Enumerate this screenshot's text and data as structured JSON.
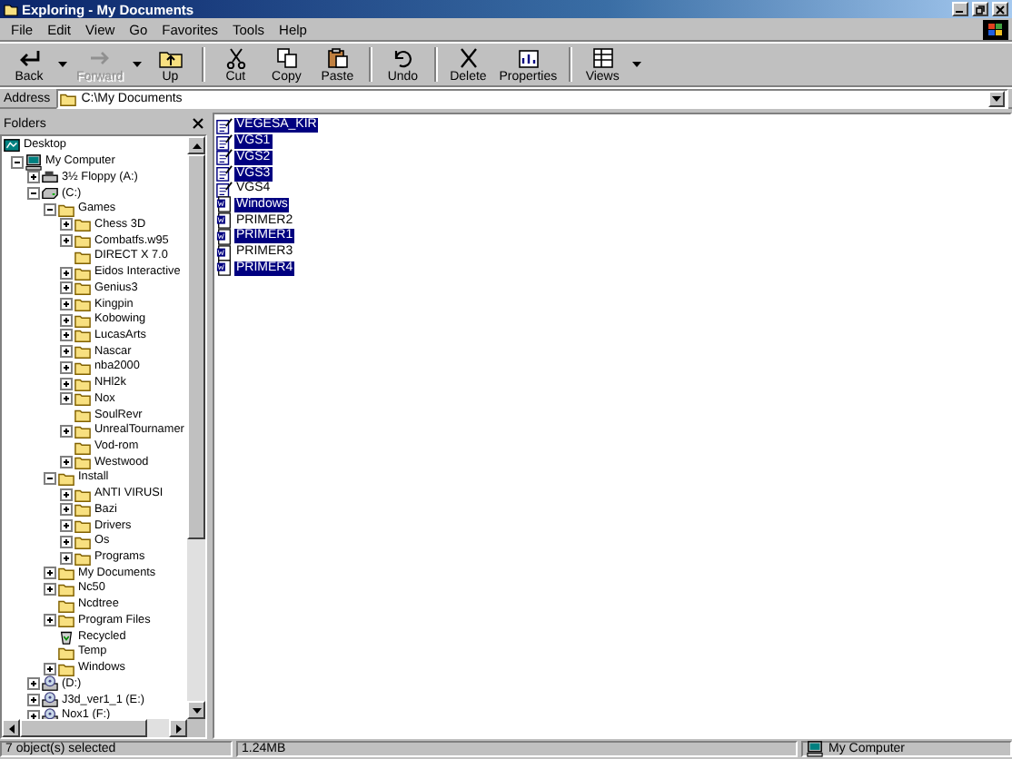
{
  "window": {
    "title": "Exploring - My Documents"
  },
  "menu": [
    "File",
    "Edit",
    "View",
    "Go",
    "Favorites",
    "Tools",
    "Help"
  ],
  "toolbar": [
    [
      {
        "label": "Back",
        "kind": "back",
        "disabled": false,
        "dropdown": true
      },
      {
        "label": "Forward",
        "kind": "forward",
        "disabled": true,
        "dropdown": true
      },
      {
        "label": "Up",
        "kind": "up",
        "disabled": false,
        "dropdown": false
      }
    ],
    [
      {
        "label": "Cut",
        "kind": "cut",
        "disabled": false,
        "dropdown": false
      },
      {
        "label": "Copy",
        "kind": "copy",
        "disabled": false,
        "dropdown": false
      },
      {
        "label": "Paste",
        "kind": "paste",
        "disabled": false,
        "dropdown": false
      }
    ],
    [
      {
        "label": "Undo",
        "kind": "undo",
        "disabled": false,
        "dropdown": false
      }
    ],
    [
      {
        "label": "Delete",
        "kind": "delete",
        "disabled": false,
        "dropdown": false
      },
      {
        "label": "Properties",
        "kind": "properties",
        "disabled": false,
        "dropdown": false
      }
    ],
    [
      {
        "label": "Views",
        "kind": "views",
        "disabled": false,
        "dropdown": true
      }
    ]
  ],
  "address": {
    "label": "Address",
    "value": "C:\\My Documents"
  },
  "folders": {
    "title": "Folders",
    "tree": [
      {
        "label": "Desktop",
        "kind": "desktop",
        "children": [
          {
            "label": "My Computer",
            "kind": "computer",
            "expanded": true,
            "children": [
              {
                "label": "3½ Floppy (A:)",
                "kind": "floppy",
                "expanded": false
              },
              {
                "label": "(C:)",
                "kind": "drive",
                "expanded": true,
                "children": [
                  {
                    "label": "Games",
                    "kind": "folder",
                    "expanded": true,
                    "children": [
                      {
                        "label": "Chess 3D",
                        "kind": "folder",
                        "expanded": false
                      },
                      {
                        "label": "Combatfs.w95",
                        "kind": "folder",
                        "expanded": false
                      },
                      {
                        "label": "DIRECT X 7.0",
                        "kind": "folder"
                      },
                      {
                        "label": "Eidos Interactive",
                        "kind": "folder",
                        "expanded": false
                      },
                      {
                        "label": "Genius3",
                        "kind": "folder",
                        "expanded": false
                      },
                      {
                        "label": "Kingpin",
                        "kind": "folder",
                        "expanded": false
                      },
                      {
                        "label": "Kobowing",
                        "kind": "folder",
                        "expanded": false
                      },
                      {
                        "label": "LucasArts",
                        "kind": "folder",
                        "expanded": false
                      },
                      {
                        "label": "Nascar",
                        "kind": "folder",
                        "expanded": false
                      },
                      {
                        "label": "nba2000",
                        "kind": "folder",
                        "expanded": false
                      },
                      {
                        "label": "NHl2k",
                        "kind": "folder",
                        "expanded": false
                      },
                      {
                        "label": "Nox",
                        "kind": "folder",
                        "expanded": false
                      },
                      {
                        "label": "SoulRevr",
                        "kind": "folder"
                      },
                      {
                        "label": "UnrealTournamer",
                        "kind": "folder",
                        "expanded": false
                      },
                      {
                        "label": "Vod-rom",
                        "kind": "folder"
                      },
                      {
                        "label": "Westwood",
                        "kind": "folder",
                        "expanded": false
                      }
                    ]
                  },
                  {
                    "label": "Install",
                    "kind": "folder",
                    "expanded": true,
                    "children": [
                      {
                        "label": "ANTI VIRUSI",
                        "kind": "folder",
                        "expanded": false
                      },
                      {
                        "label": "Bazi",
                        "kind": "folder",
                        "expanded": false
                      },
                      {
                        "label": "Drivers",
                        "kind": "folder",
                        "expanded": false
                      },
                      {
                        "label": "Os",
                        "kind": "folder",
                        "expanded": false
                      },
                      {
                        "label": "Programs",
                        "kind": "folder",
                        "expanded": false
                      }
                    ]
                  },
                  {
                    "label": "My Documents",
                    "kind": "folder",
                    "expanded": false
                  },
                  {
                    "label": "Nc50",
                    "kind": "folder",
                    "expanded": false
                  },
                  {
                    "label": "Ncdtree",
                    "kind": "folder"
                  },
                  {
                    "label": "Program Files",
                    "kind": "folder",
                    "expanded": false
                  },
                  {
                    "label": "Recycled",
                    "kind": "recycle"
                  },
                  {
                    "label": "Temp",
                    "kind": "folder"
                  },
                  {
                    "label": "Windows",
                    "kind": "folder",
                    "expanded": false
                  }
                ]
              },
              {
                "label": "(D:)",
                "kind": "cd",
                "expanded": false
              },
              {
                "label": "J3d_ver1_1 (E:)",
                "kind": "cd",
                "expanded": false
              },
              {
                "label": "Nox1 (F:)",
                "kind": "cd",
                "expanded": false
              }
            ]
          }
        ]
      }
    ]
  },
  "files": [
    {
      "name": "VEGESA_KIR",
      "kind": "text",
      "selected": true
    },
    {
      "name": "VGS1",
      "kind": "text",
      "selected": true
    },
    {
      "name": "VGS2",
      "kind": "text",
      "selected": true
    },
    {
      "name": "VGS3",
      "kind": "text",
      "selected": true
    },
    {
      "name": "VGS4",
      "kind": "text",
      "selected": false
    },
    {
      "name": "Windows",
      "kind": "word",
      "selected": true
    },
    {
      "name": "PRIMER2",
      "kind": "word",
      "selected": false
    },
    {
      "name": "PRIMER1",
      "kind": "word",
      "selected": true
    },
    {
      "name": "PRIMER3",
      "kind": "word",
      "selected": false
    },
    {
      "name": "PRIMER4",
      "kind": "word",
      "selected": true
    }
  ],
  "status_bar": [
    {
      "text": "7 object(s) selected",
      "kind": "plain"
    },
    {
      "text": "1.24MB",
      "kind": "plain"
    },
    {
      "text": "My Computer",
      "kind": "computer"
    }
  ]
}
